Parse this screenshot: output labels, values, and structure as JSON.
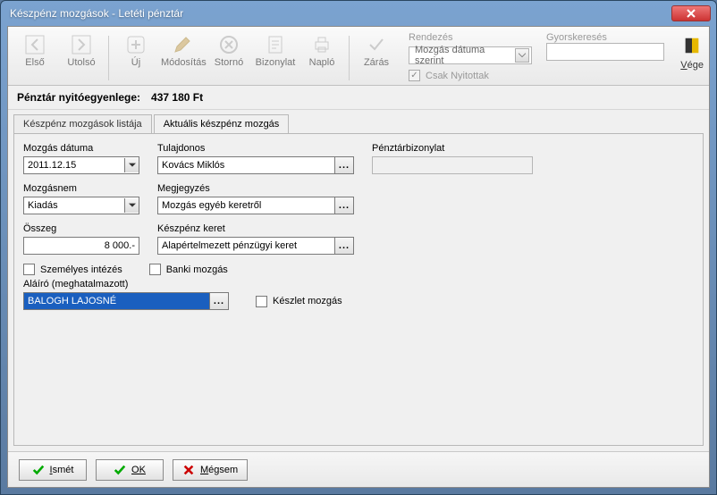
{
  "window": {
    "title": "Készpénz mozgások - Letéti pénztár"
  },
  "toolbar": {
    "first": "Első",
    "last": "Utolsó",
    "new": "Új",
    "edit": "Módosítás",
    "storno": "Stornó",
    "receipt": "Bizonylat",
    "log": "Napló",
    "close": "Zárás",
    "order_label": "Rendezés",
    "order_value": "Mozgás dátuma szerint",
    "only_open": "Csak Nyitottak",
    "search_label": "Gyorskeresés",
    "search_value": "",
    "end": "Vége"
  },
  "balance": {
    "label": "Pénztár nyitóegyenlege:",
    "value": "437 180 Ft"
  },
  "tabs": {
    "list": "Készpénz mozgások listája",
    "current": "Aktuális készpénz mozgás"
  },
  "form": {
    "date_label": "Mozgás dátuma",
    "date_value": "2011.12.15",
    "owner_label": "Tulajdonos",
    "owner_value": "Kovács Miklós",
    "receipt_label": "Pénztárbizonylat",
    "receipt_value": "",
    "type_label": "Mozgásnem",
    "type_value": "Kiadás",
    "note_label": "Megjegyzés",
    "note_value": "Mozgás egyéb keretről",
    "amount_label": "Összeg",
    "amount_value": "8 000.-",
    "frame_label": "Készpénz keret",
    "frame_value": "Alapértelmezett pénzügyi keret",
    "personal": "Személyes intézés",
    "bank": "Banki mozgás",
    "signer_label": "Aláíró (meghatalmazott)",
    "signer_value": "BALOGH  LAJOSNÉ",
    "stock": "Készlet mozgás"
  },
  "buttons": {
    "again": "Ismét",
    "ok": "OK",
    "cancel": "Mégsem"
  }
}
